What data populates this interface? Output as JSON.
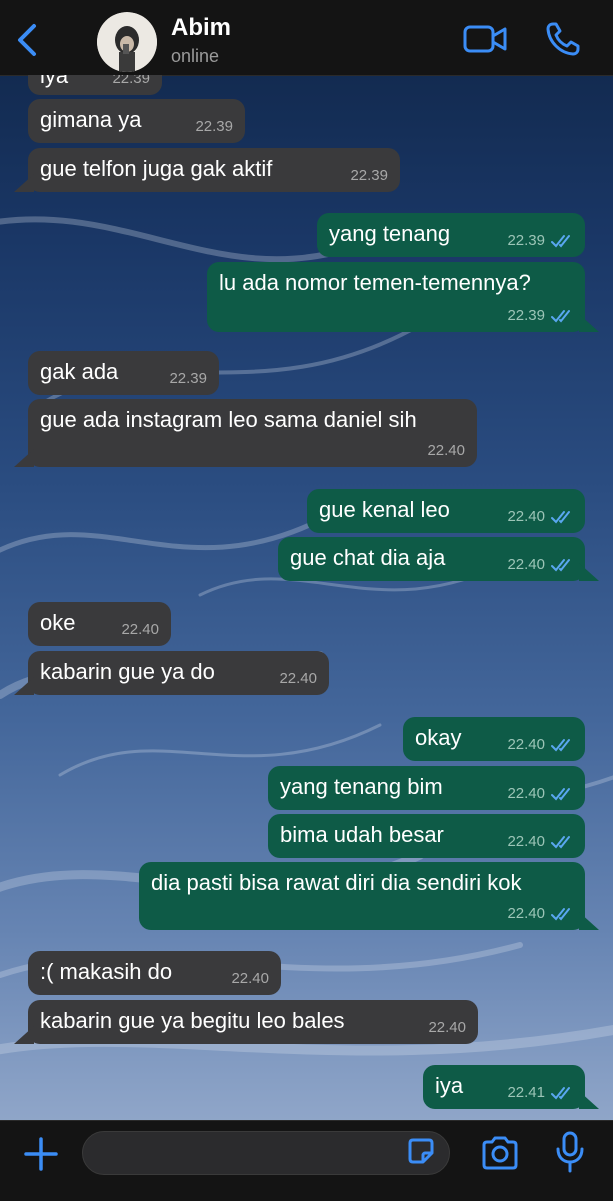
{
  "header": {
    "contact_name": "Abim",
    "status": "online"
  },
  "icons": {
    "back": "chevron-left-icon",
    "video": "video-icon",
    "call": "phone-icon",
    "plus": "plus-icon",
    "sticker": "sticker-icon",
    "camera": "camera-icon",
    "mic": "microphone-icon",
    "read": "double-check-icon"
  },
  "colors": {
    "accent": "#3b8df6",
    "incoming_bubble": "#3a3a3c",
    "outgoing_bubble": "#0e5b47",
    "read_tick": "#5aa7f0",
    "bar_background": "#141414"
  },
  "messages": [
    {
      "direction": "in",
      "text": "iya",
      "time": "22.39"
    },
    {
      "direction": "in",
      "text": "gimana ya",
      "time": "22.39"
    },
    {
      "direction": "in",
      "text": "gue telfon juga gak aktif",
      "time": "22.39"
    },
    {
      "direction": "out",
      "text": "yang tenang",
      "time": "22.39",
      "read": true
    },
    {
      "direction": "out",
      "text": "lu ada nomor temen-temennya?",
      "time": "22.39",
      "read": true
    },
    {
      "direction": "in",
      "text": "gak ada",
      "time": "22.39"
    },
    {
      "direction": "in",
      "text": "gue ada instagram leo sama daniel sih",
      "time": "22.40"
    },
    {
      "direction": "out",
      "text": "gue kenal leo",
      "time": "22.40",
      "read": true
    },
    {
      "direction": "out",
      "text": "gue chat dia aja",
      "time": "22.40",
      "read": true
    },
    {
      "direction": "in",
      "text": "oke",
      "time": "22.40"
    },
    {
      "direction": "in",
      "text": "kabarin gue ya do",
      "time": "22.40"
    },
    {
      "direction": "out",
      "text": "okay",
      "time": "22.40",
      "read": true
    },
    {
      "direction": "out",
      "text": "yang tenang bim",
      "time": "22.40",
      "read": true
    },
    {
      "direction": "out",
      "text": "bima udah besar",
      "time": "22.40",
      "read": true
    },
    {
      "direction": "out",
      "text": "dia pasti bisa rawat diri dia sendiri kok",
      "time": "22.40",
      "read": true
    },
    {
      "direction": "in",
      "text": ":( makasih do",
      "time": "22.40"
    },
    {
      "direction": "in",
      "text": "kabarin gue ya begitu leo bales",
      "time": "22.40"
    },
    {
      "direction": "out",
      "text": "iya",
      "time": "22.41",
      "read": true
    }
  ],
  "composer": {
    "placeholder": "",
    "value": ""
  }
}
